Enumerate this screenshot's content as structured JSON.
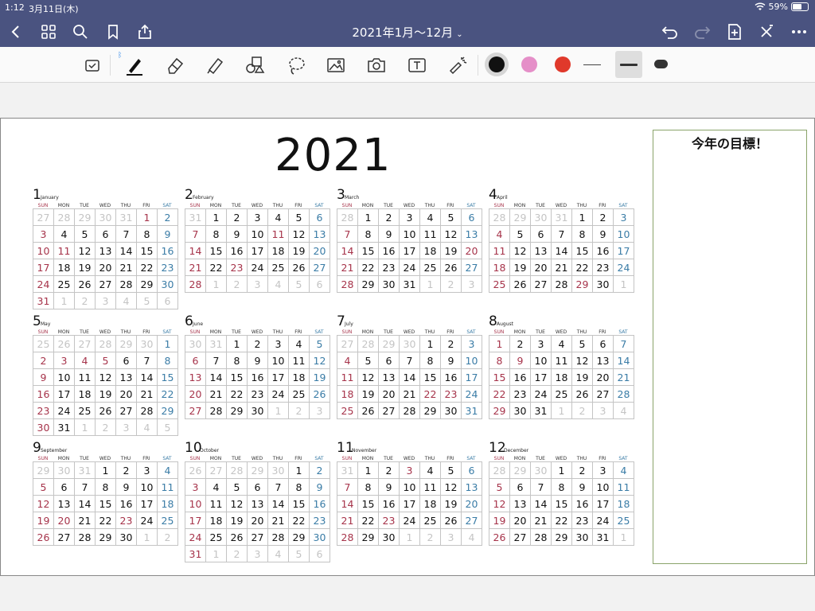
{
  "status_bar": {
    "time": "1:12",
    "date": "3月11日(木)",
    "battery": "59%",
    "battery_level": 0.59
  },
  "nav": {
    "title": "2021年1月〜12月",
    "icons": [
      "back-icon",
      "grid-icon",
      "search-icon",
      "bookmark-icon",
      "share-icon",
      "undo-icon",
      "redo-icon",
      "add-page-icon",
      "close-x-icon",
      "more-icon"
    ]
  },
  "toolbar": {
    "tools": [
      "read-only-icon",
      "pen-icon",
      "eraser-icon",
      "highlighter-icon",
      "shapes-icon",
      "lasso-icon",
      "image-icon",
      "camera-icon",
      "text-icon",
      "laser-pointer-icon"
    ],
    "colors": [
      "#111111",
      "#e58fc8",
      "#e0392b"
    ],
    "selected_color": "#111111",
    "stroke_widths": [
      "thin",
      "medium",
      "thick"
    ],
    "selected_stroke": "medium"
  },
  "calendar": {
    "year": "2021",
    "weekdays": [
      "SUN",
      "MON",
      "TUE",
      "WED",
      "THU",
      "FRI",
      "SAT"
    ],
    "months": [
      {
        "num": "1",
        "name": "January",
        "days": [
          [
            "27",
            "28",
            "29",
            "30",
            "31",
            "1",
            "2"
          ],
          [
            "3",
            "4",
            "5",
            "6",
            "7",
            "8",
            "9"
          ],
          [
            "10",
            "11",
            "12",
            "13",
            "14",
            "15",
            "16"
          ],
          [
            "17",
            "18",
            "19",
            "20",
            "21",
            "22",
            "23"
          ],
          [
            "24",
            "25",
            "26",
            "27",
            "28",
            "29",
            "30"
          ],
          [
            "31",
            "1",
            "2",
            "3",
            "4",
            "5",
            "6"
          ]
        ]
      },
      {
        "num": "2",
        "name": "February",
        "days": [
          [
            "31",
            "1",
            "2",
            "3",
            "4",
            "5",
            "6"
          ],
          [
            "7",
            "8",
            "9",
            "10",
            "11",
            "12",
            "13"
          ],
          [
            "14",
            "15",
            "16",
            "17",
            "18",
            "19",
            "20"
          ],
          [
            "21",
            "22",
            "23",
            "24",
            "25",
            "26",
            "27"
          ],
          [
            "28",
            "1",
            "2",
            "3",
            "4",
            "5",
            "6"
          ]
        ]
      },
      {
        "num": "3",
        "name": "March",
        "days": [
          [
            "28",
            "1",
            "2",
            "3",
            "4",
            "5",
            "6"
          ],
          [
            "7",
            "8",
            "9",
            "10",
            "11",
            "12",
            "13"
          ],
          [
            "14",
            "15",
            "16",
            "17",
            "18",
            "19",
            "20"
          ],
          [
            "21",
            "22",
            "23",
            "24",
            "25",
            "26",
            "27"
          ],
          [
            "28",
            "29",
            "30",
            "31",
            "1",
            "2",
            "3"
          ]
        ]
      },
      {
        "num": "4",
        "name": "April",
        "days": [
          [
            "28",
            "29",
            "30",
            "31",
            "1",
            "2",
            "3"
          ],
          [
            "4",
            "5",
            "6",
            "7",
            "8",
            "9",
            "10"
          ],
          [
            "11",
            "12",
            "13",
            "14",
            "15",
            "16",
            "17"
          ],
          [
            "18",
            "19",
            "20",
            "21",
            "22",
            "23",
            "24"
          ],
          [
            "25",
            "26",
            "27",
            "28",
            "29",
            "30",
            "1"
          ]
        ]
      },
      {
        "num": "5",
        "name": "May",
        "days": [
          [
            "25",
            "26",
            "27",
            "28",
            "29",
            "30",
            "1"
          ],
          [
            "2",
            "3",
            "4",
            "5",
            "6",
            "7",
            "8"
          ],
          [
            "9",
            "10",
            "11",
            "12",
            "13",
            "14",
            "15"
          ],
          [
            "16",
            "17",
            "18",
            "19",
            "20",
            "21",
            "22"
          ],
          [
            "23",
            "24",
            "25",
            "26",
            "27",
            "28",
            "29"
          ],
          [
            "30",
            "31",
            "1",
            "2",
            "3",
            "4",
            "5"
          ]
        ]
      },
      {
        "num": "6",
        "name": "June",
        "days": [
          [
            "30",
            "31",
            "1",
            "2",
            "3",
            "4",
            "5"
          ],
          [
            "6",
            "7",
            "8",
            "9",
            "10",
            "11",
            "12"
          ],
          [
            "13",
            "14",
            "15",
            "16",
            "17",
            "18",
            "19"
          ],
          [
            "20",
            "21",
            "22",
            "23",
            "24",
            "25",
            "26"
          ],
          [
            "27",
            "28",
            "29",
            "30",
            "1",
            "2",
            "3"
          ]
        ]
      },
      {
        "num": "7",
        "name": "July",
        "days": [
          [
            "27",
            "28",
            "29",
            "30",
            "1",
            "2",
            "3"
          ],
          [
            "4",
            "5",
            "6",
            "7",
            "8",
            "9",
            "10"
          ],
          [
            "11",
            "12",
            "13",
            "14",
            "15",
            "16",
            "17"
          ],
          [
            "18",
            "19",
            "20",
            "21",
            "22",
            "23",
            "24"
          ],
          [
            "25",
            "26",
            "27",
            "28",
            "29",
            "30",
            "31"
          ]
        ]
      },
      {
        "num": "8",
        "name": "August",
        "days": [
          [
            "1",
            "2",
            "3",
            "4",
            "5",
            "6",
            "7"
          ],
          [
            "8",
            "9",
            "10",
            "11",
            "12",
            "13",
            "14"
          ],
          [
            "15",
            "16",
            "17",
            "18",
            "19",
            "20",
            "21"
          ],
          [
            "22",
            "23",
            "24",
            "25",
            "26",
            "27",
            "28"
          ],
          [
            "29",
            "30",
            "31",
            "1",
            "2",
            "3",
            "4"
          ]
        ]
      },
      {
        "num": "9",
        "name": "September",
        "days": [
          [
            "29",
            "30",
            "31",
            "1",
            "2",
            "3",
            "4"
          ],
          [
            "5",
            "6",
            "7",
            "8",
            "9",
            "10",
            "11"
          ],
          [
            "12",
            "13",
            "14",
            "15",
            "16",
            "17",
            "18"
          ],
          [
            "19",
            "20",
            "21",
            "22",
            "23",
            "24",
            "25"
          ],
          [
            "26",
            "27",
            "28",
            "29",
            "30",
            "1",
            "2"
          ]
        ]
      },
      {
        "num": "10",
        "name": "October",
        "days": [
          [
            "26",
            "27",
            "28",
            "29",
            "30",
            "1",
            "2"
          ],
          [
            "3",
            "4",
            "5",
            "6",
            "7",
            "8",
            "9"
          ],
          [
            "10",
            "11",
            "12",
            "13",
            "14",
            "15",
            "16"
          ],
          [
            "17",
            "18",
            "19",
            "20",
            "21",
            "22",
            "23"
          ],
          [
            "24",
            "25",
            "26",
            "27",
            "28",
            "29",
            "30"
          ],
          [
            "31",
            "1",
            "2",
            "3",
            "4",
            "5",
            "6"
          ]
        ]
      },
      {
        "num": "11",
        "name": "November",
        "days": [
          [
            "31",
            "1",
            "2",
            "3",
            "4",
            "5",
            "6"
          ],
          [
            "7",
            "8",
            "9",
            "10",
            "11",
            "12",
            "13"
          ],
          [
            "14",
            "15",
            "16",
            "17",
            "18",
            "19",
            "20"
          ],
          [
            "21",
            "22",
            "23",
            "24",
            "25",
            "26",
            "27"
          ],
          [
            "28",
            "29",
            "30",
            "1",
            "2",
            "3",
            "4"
          ]
        ]
      },
      {
        "num": "12",
        "name": "December",
        "days": [
          [
            "28",
            "29",
            "30",
            "1",
            "2",
            "3",
            "4"
          ],
          [
            "5",
            "6",
            "7",
            "8",
            "9",
            "10",
            "11"
          ],
          [
            "12",
            "13",
            "14",
            "15",
            "16",
            "17",
            "18"
          ],
          [
            "19",
            "20",
            "21",
            "22",
            "23",
            "24",
            "25"
          ],
          [
            "26",
            "27",
            "28",
            "29",
            "30",
            "31",
            "1"
          ]
        ]
      }
    ],
    "holidays": {
      "1": [
        "1",
        "11"
      ],
      "2": [
        "11",
        "23"
      ],
      "3": [
        "20"
      ],
      "4": [
        "29"
      ],
      "5": [
        "3",
        "4",
        "5"
      ],
      "6": [],
      "7": [
        "22",
        "23"
      ],
      "8": [
        "9"
      ],
      "9": [
        "20",
        "23"
      ],
      "10": [],
      "11": [
        "3",
        "23"
      ],
      "12": []
    }
  },
  "goal_box": {
    "title": "今年の目標！"
  }
}
